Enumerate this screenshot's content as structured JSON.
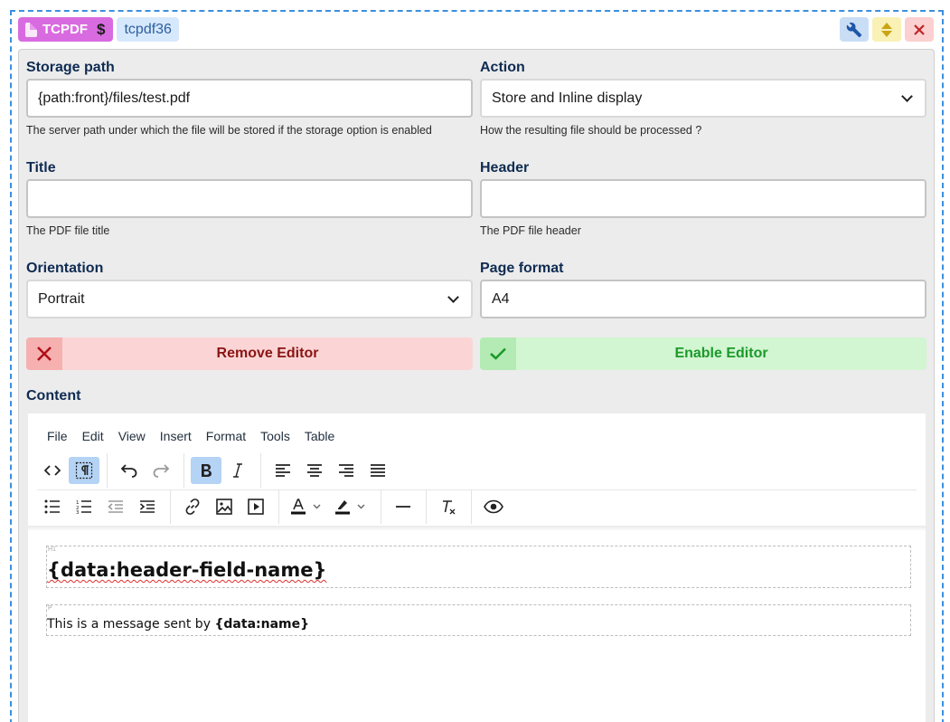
{
  "header": {
    "badge_label": "TCPDF",
    "badge_dollar": "$",
    "instance_id": "tcpdf36"
  },
  "fields": {
    "storage_path": {
      "label": "Storage path",
      "value": "{path:front}/files/test.pdf",
      "help": "The server path under which the file will be stored if the storage option is enabled"
    },
    "action": {
      "label": "Action",
      "value": "Store and Inline display",
      "help": "How the resulting file should be processed ?"
    },
    "title": {
      "label": "Title",
      "value": "",
      "help": "The PDF file title"
    },
    "header": {
      "label": "Header",
      "value": "",
      "help": "The PDF file header"
    },
    "orientation": {
      "label": "Orientation",
      "value": "Portrait"
    },
    "page_format": {
      "label": "Page format",
      "value": "A4"
    }
  },
  "editor_buttons": {
    "remove": "Remove Editor",
    "enable": "Enable Editor"
  },
  "content": {
    "label": "Content",
    "menu": [
      "File",
      "Edit",
      "View",
      "Insert",
      "Format",
      "Tools",
      "Table"
    ],
    "block1_tag": "H1",
    "block1_text": "{data:header-field-name}",
    "block2_tag": "P",
    "block2_prefix": "This is a message sent by ",
    "block2_bold": "{data:name}"
  },
  "colors": {
    "badge": "#d96be0",
    "frame": "#3b8fe0",
    "remove_bg": "#fbd5d5",
    "enable_bg": "#d2f5d2",
    "toolbar_active": "#b4d3f5"
  }
}
